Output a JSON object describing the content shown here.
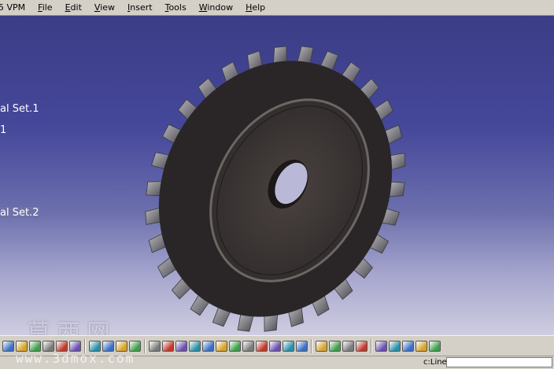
{
  "window": {
    "app_title": "5 VPM"
  },
  "menu": {
    "items": [
      {
        "label": "File",
        "accel": "F",
        "rest": "ile"
      },
      {
        "label": "Edit",
        "accel": "E",
        "rest": "dit"
      },
      {
        "label": "View",
        "accel": "V",
        "rest": "iew"
      },
      {
        "label": "Insert",
        "accel": "I",
        "rest": "nsert"
      },
      {
        "label": "Tools",
        "accel": "T",
        "rest": "ools"
      },
      {
        "label": "Window",
        "accel": "W",
        "rest": "indow"
      },
      {
        "label": "Help",
        "accel": "H",
        "rest": "elp"
      }
    ]
  },
  "tree": {
    "items": [
      {
        "label": "al Set.1",
        "selected": false
      },
      {
        "label": "1",
        "selected": false
      },
      {
        "label": "al Set.2",
        "selected": true
      }
    ]
  },
  "colors": {
    "background_top": "#3c3d86",
    "background_bottom": "#cfcde0",
    "gear_tooth": "#8a8a8e",
    "gear_face": "#3a3432",
    "toolbar": "#d4d0c8"
  },
  "watermark": {
    "chinese": "莫西网",
    "url": "www.3dmox.com"
  },
  "toolbar": {
    "icons": [
      "copy-icon",
      "paste-icon",
      "arrow-down-icon",
      "help-query-icon",
      "function-fog-icon",
      "comment-icon",
      "table-icon",
      "tree-expand-icon",
      "lock-icon",
      "catalog-icon",
      "fly-mode-icon",
      "rotate-icon",
      "pan-icon",
      "rotate-view-icon",
      "zoom-in-icon",
      "zoom-out-icon",
      "normal-view-icon",
      "quick-view-icon",
      "iso-view-icon",
      "cylinder-icon",
      "render-icon",
      "snapshot-icon",
      "swap-icon",
      "hide-show-icon",
      "measure-icon",
      "pipe-icon",
      "camera-icon",
      "spiral-icon",
      "spin-icon",
      "compass-icon",
      "axis-icon"
    ]
  },
  "status": {
    "prompt": "c:Line",
    "input_value": ""
  }
}
